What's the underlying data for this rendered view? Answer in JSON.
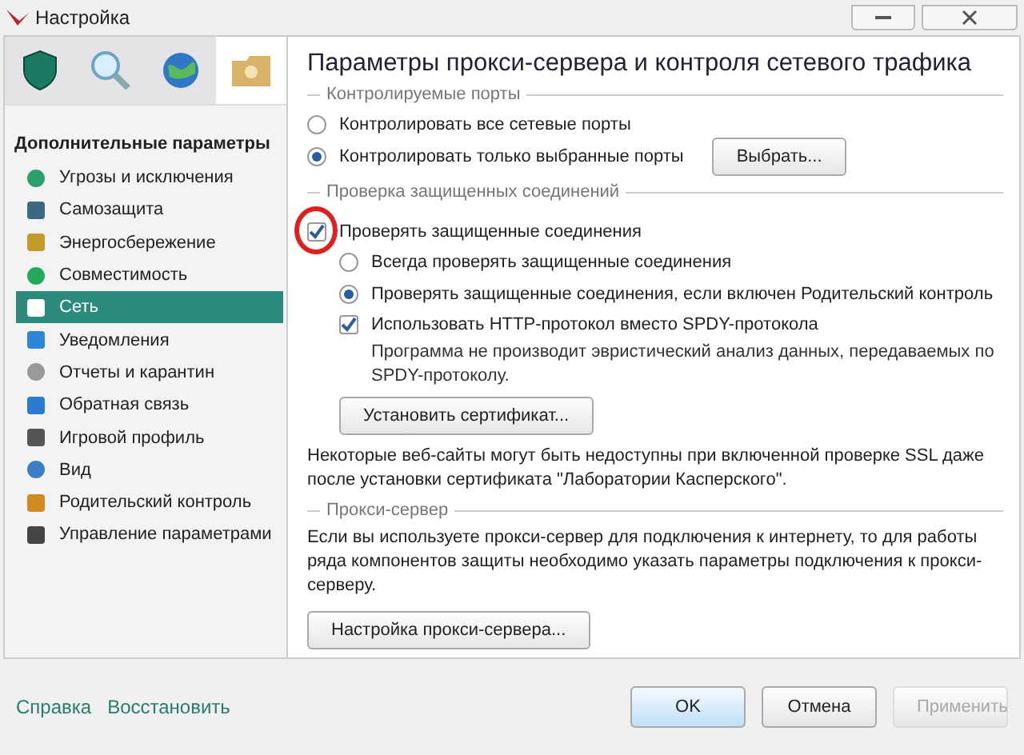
{
  "window": {
    "title": "Настройка"
  },
  "tabs": [
    {
      "selected": false
    },
    {
      "selected": false
    },
    {
      "selected": false
    },
    {
      "selected": true
    }
  ],
  "sidebar": {
    "heading": "Дополнительные параметры",
    "items": [
      {
        "label": "Угрозы и исключения",
        "selected": false
      },
      {
        "label": "Самозащита",
        "selected": false
      },
      {
        "label": "Энергосбережение",
        "selected": false
      },
      {
        "label": "Совместимость",
        "selected": false
      },
      {
        "label": "Сеть",
        "selected": true
      },
      {
        "label": "Уведомления",
        "selected": false
      },
      {
        "label": "Отчеты и карантин",
        "selected": false
      },
      {
        "label": "Обратная связь",
        "selected": false
      },
      {
        "label": "Игровой профиль",
        "selected": false
      },
      {
        "label": "Вид",
        "selected": false
      },
      {
        "label": "Родительский контроль",
        "selected": false
      },
      {
        "label": "Управление параметрами",
        "selected": false
      }
    ]
  },
  "page_title": "Параметры прокси-сервера и контроля сетевого трафика",
  "sections": [
    {
      "legend": "Контролируемые порты",
      "items": [
        {
          "kind": "radio",
          "label": "Контролировать все сетевые порты",
          "selected": false
        },
        {
          "kind": "radio",
          "label": "Контролировать только выбранные порты",
          "selected": true,
          "button": "Выбрать..."
        }
      ]
    },
    {
      "legend": "Проверка защищенных соединений",
      "items": [
        {
          "kind": "checkbox",
          "label": "Проверять защищенные соединения",
          "checked": true,
          "highlight": true
        },
        {
          "kind": "radio",
          "label": "Всегда проверять защищенные соединения",
          "selected": false,
          "indent": true
        },
        {
          "kind": "radio",
          "label": "Проверять защищенные соединения, если включен Родительский контроль",
          "selected": true,
          "indent": true
        },
        {
          "kind": "checkbox",
          "label": "Использовать HTTP-протокол вместо SPDY-протокола",
          "checked": true,
          "indent": true,
          "note": "Программа не производит эвристический анализ данных, передаваемых по SPDY-протоколу."
        },
        {
          "kind": "button",
          "label": "Установить сертификат...",
          "indent": true
        },
        {
          "kind": "text",
          "label": "Некоторые веб-сайты могут быть недоступны при включенной проверке SSL даже после установки сертификата \"Лаборатории Касперского\"."
        }
      ]
    },
    {
      "legend": "Прокси-сервер",
      "items": [
        {
          "kind": "text",
          "label": "Если вы используете прокси-сервер для подключения к интернету, то для работы ряда компонентов защиты необходимо указать параметры подключения к прокси-серверу."
        },
        {
          "kind": "button",
          "label": "Настройка прокси-сервера..."
        }
      ]
    }
  ],
  "footer": {
    "links": [
      "Справка",
      "Восстановить"
    ],
    "buttons": [
      {
        "label": "OK",
        "kind": "default",
        "disabled": false
      },
      {
        "label": "Отмена",
        "kind": "normal",
        "disabled": false
      },
      {
        "label": "Применить",
        "kind": "normal",
        "disabled": true
      }
    ]
  }
}
